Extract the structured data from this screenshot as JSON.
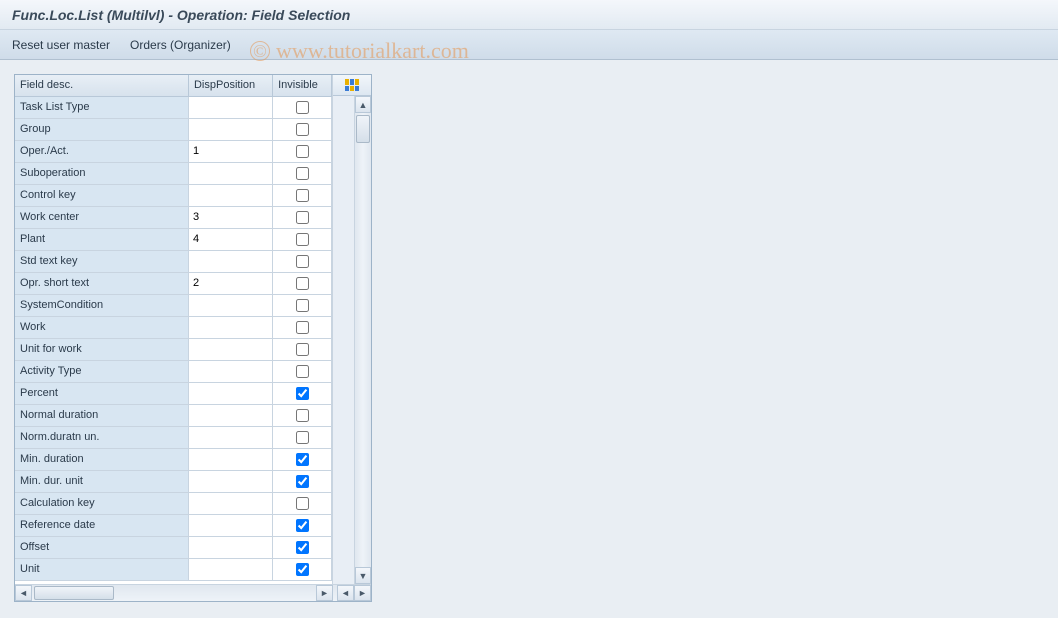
{
  "title": "Func.Loc.List (Multilvl) - Operation: Field Selection",
  "toolbar": {
    "reset": "Reset user master",
    "orders": "Orders (Organizer)"
  },
  "columns": {
    "desc": "Field desc.",
    "pos": "DispPosition",
    "inv": "Invisible"
  },
  "rows": [
    {
      "desc": "Task List Type",
      "pos": "",
      "inv": false
    },
    {
      "desc": "Group",
      "pos": "",
      "inv": false
    },
    {
      "desc": "Oper./Act.",
      "pos": "1",
      "inv": false
    },
    {
      "desc": "Suboperation",
      "pos": "",
      "inv": false
    },
    {
      "desc": "Control key",
      "pos": "",
      "inv": false
    },
    {
      "desc": "Work center",
      "pos": "3",
      "inv": false
    },
    {
      "desc": "Plant",
      "pos": "4",
      "inv": false
    },
    {
      "desc": "Std text key",
      "pos": "",
      "inv": false
    },
    {
      "desc": "Opr. short text",
      "pos": "2",
      "inv": false
    },
    {
      "desc": "SystemCondition",
      "pos": "",
      "inv": false
    },
    {
      "desc": "Work",
      "pos": "",
      "inv": false
    },
    {
      "desc": "Unit for work",
      "pos": "",
      "inv": false
    },
    {
      "desc": "Activity Type",
      "pos": "",
      "inv": false
    },
    {
      "desc": "Percent",
      "pos": "",
      "inv": true
    },
    {
      "desc": "Normal duration",
      "pos": "",
      "inv": false
    },
    {
      "desc": "Norm.duratn un.",
      "pos": "",
      "inv": false
    },
    {
      "desc": "Min. duration",
      "pos": "",
      "inv": true
    },
    {
      "desc": "Min. dur. unit",
      "pos": "",
      "inv": true
    },
    {
      "desc": "Calculation key",
      "pos": "",
      "inv": false
    },
    {
      "desc": "Reference date",
      "pos": "",
      "inv": true
    },
    {
      "desc": "Offset",
      "pos": "",
      "inv": true
    },
    {
      "desc": "Unit",
      "pos": "",
      "inv": true
    }
  ],
  "watermark": "www.tutorialkart.com"
}
